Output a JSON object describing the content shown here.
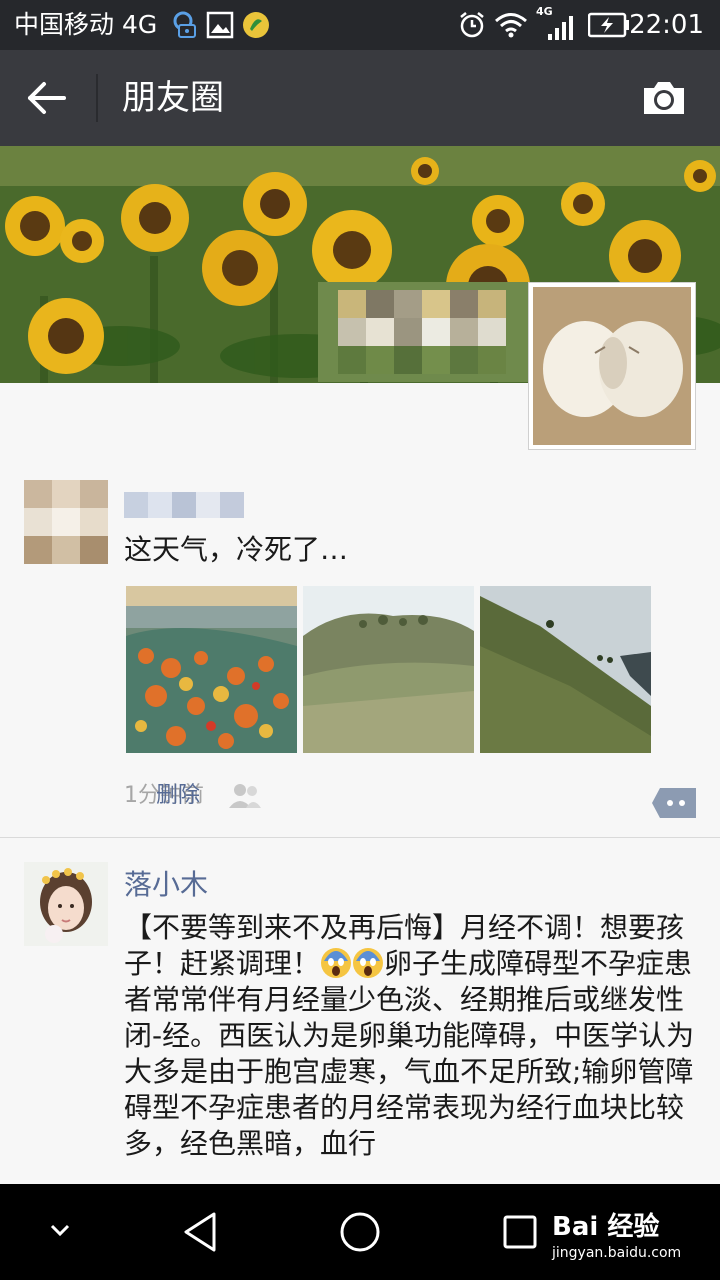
{
  "status_bar": {
    "carrier": "中国移动 4G",
    "network_badge": "4G",
    "time": "22:01"
  },
  "header": {
    "title": "朋友圈"
  },
  "posts": [
    {
      "author": "",
      "text": "这天气，冷死了…",
      "time_ago": "1分钟前",
      "delete_label": "删除",
      "photos": [
        "photo-autumn-forest",
        "photo-green-hill",
        "photo-hillside-slope"
      ]
    },
    {
      "author": "落小木",
      "text_part1": "【不要等到来不及再后悔】月经不调！想要孩子！赶紧调理！",
      "text_part2": "卵子生成障碍型不孕症患者常常伴有月经量少色淡、经期推后或继发性闭-经。西医认为是卵巢功能障碍，中医学认为大多是由于胞宫虚寒，气血不足所致;输卵管障碍型不孕症患者的月经常表现为经行血块比较多，经色黑暗，血行"
    }
  ],
  "nav_bar": {
    "watermark_brand": "Bai 经验",
    "watermark_url": "jingyan.baidu.com"
  },
  "colors": {
    "status_bar_bg": "#26282c",
    "title_bar_bg": "#393a3f",
    "link_blue": "#576b95",
    "page_bg": "#f7f7f7"
  }
}
